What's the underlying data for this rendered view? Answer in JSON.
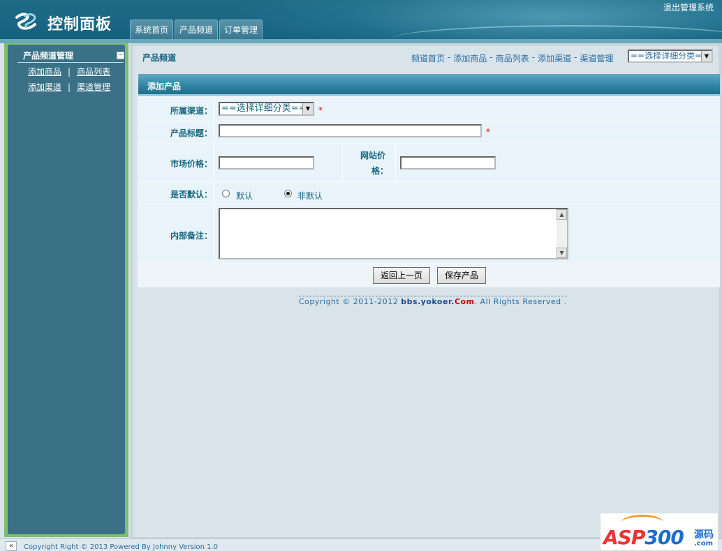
{
  "header": {
    "title": "控制面板",
    "logout_label": "退出管理系统",
    "tabs": [
      "系统首页",
      "产品频道",
      "订单管理"
    ]
  },
  "sidebar": {
    "title": "产品频道管理",
    "collapse_icon": "minus-icon",
    "rows": [
      [
        "添加商品",
        "商品列表"
      ],
      [
        "添加渠道",
        "渠道管理"
      ]
    ],
    "separator": "|"
  },
  "main": {
    "section_title": "产品频道",
    "crumbs": [
      "频道首页",
      "添加商品",
      "商品列表",
      "添加渠道",
      "渠道管理"
    ],
    "crumb_prefix": "-",
    "category_select": "==选择详细分类=="
  },
  "form": {
    "title": "添加产品",
    "channel_label": "所属渠道：",
    "channel_select": "==选择详细分类==",
    "required_mark": "*",
    "product_title_label": "产品标题：",
    "product_title_value": "",
    "market_price_label": "市场价格：",
    "market_price_value": "",
    "site_price_label_1": "网站价",
    "site_price_label_2": "格：",
    "site_price_value": "",
    "default_label": "是否默认：",
    "default_options": [
      "默认",
      "非默认"
    ],
    "default_selected": "非默认",
    "notes_label": "内部备注：",
    "notes_value": "",
    "back_button": "返回上一页",
    "save_button": "保存产品"
  },
  "copyright": {
    "prefix": "Copyright © 2011-2012 ",
    "domain": "bbs.yokoer.",
    "tld": "Com",
    "suffix": ". All Rights Reserved ."
  },
  "footer": {
    "toggle": "«",
    "text": "Copyright Right © 2013 Powered By Johnny Version 1.0"
  },
  "watermark": {
    "asp": "ASP",
    "num": "300",
    "yuan": "源码",
    "com": ".com"
  },
  "colors": {
    "header_bg": "#186684",
    "sidebar_bg": "#3a7187",
    "sidebar_border": "#7fbf6a",
    "label_color": "#176780",
    "link_color": "#2a6da0",
    "required": "#dd0000"
  }
}
